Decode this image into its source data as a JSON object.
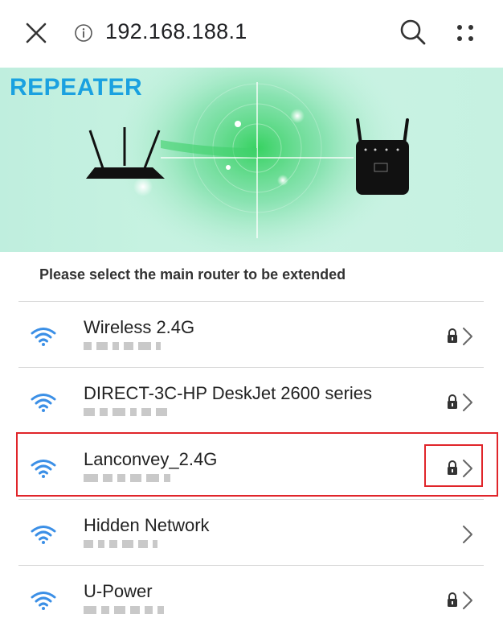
{
  "browser": {
    "url": "192.168.188.1"
  },
  "banner": {
    "title": "REPEATER"
  },
  "page": {
    "subtitle": "Please select the main router to be extended"
  },
  "networks": [
    {
      "ssid": "Wireless 2.4G",
      "secured": true
    },
    {
      "ssid": "DIRECT-3C-HP DeskJet 2600 series",
      "secured": true
    },
    {
      "ssid": "Lanconvey_2.4G",
      "secured": true
    },
    {
      "ssid": "Hidden Network",
      "secured": false
    },
    {
      "ssid": "U-Power",
      "secured": true
    }
  ],
  "colors": {
    "accent_title": "#1aa1e0",
    "wifi_icon": "#3b8fe6",
    "highlight_border": "#e0252a"
  }
}
